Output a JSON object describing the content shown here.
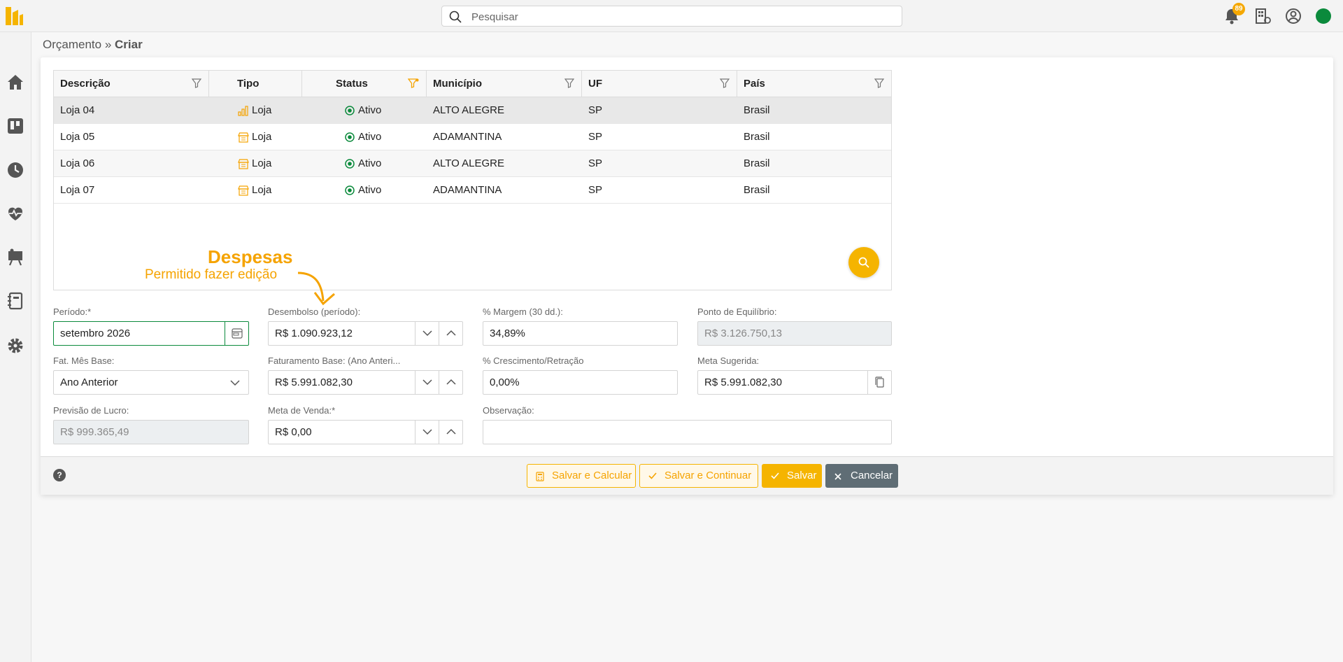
{
  "search": {
    "placeholder": "Pesquisar"
  },
  "header": {
    "notification_count": "89"
  },
  "breadcrumb": {
    "parent": "Orçamento",
    "separator": "»",
    "current": "Criar"
  },
  "grid": {
    "columns": [
      "Descrição",
      "Tipo",
      "Status",
      "Município",
      "UF",
      "País"
    ],
    "rows": [
      {
        "descricao": "Loja 04",
        "tipo": "Loja",
        "status": "Ativo",
        "municipio": "ALTO ALEGRE",
        "uf": "SP",
        "pais": "Brasil"
      },
      {
        "descricao": "Loja 05",
        "tipo": "Loja",
        "status": "Ativo",
        "municipio": "ADAMANTINA",
        "uf": "SP",
        "pais": "Brasil"
      },
      {
        "descricao": "Loja 06",
        "tipo": "Loja",
        "status": "Ativo",
        "municipio": "ALTO ALEGRE",
        "uf": "SP",
        "pais": "Brasil"
      },
      {
        "descricao": "Loja 07",
        "tipo": "Loja",
        "status": "Ativo",
        "municipio": "ADAMANTINA",
        "uf": "SP",
        "pais": "Brasil"
      }
    ]
  },
  "annotation": {
    "title": "Despesas",
    "subtitle": "Permitido fazer edição"
  },
  "form": {
    "periodo": {
      "label": "Período:*",
      "value": "setembro 2026"
    },
    "desembolso": {
      "label": "Desembolso (período):",
      "value": "R$ 1.090.923,12"
    },
    "margem": {
      "label": "% Margem (30 dd.):",
      "value": "34,89%"
    },
    "ponto_equilibrio": {
      "label": "Ponto de Equilíbrio:",
      "value": "R$ 3.126.750,13"
    },
    "fat_mes_base": {
      "label": "Fat. Mês Base:",
      "value": "Ano Anterior"
    },
    "faturamento_base": {
      "label": "Faturamento Base: (Ano Anteri...",
      "value": "R$ 5.991.082,30"
    },
    "crescimento": {
      "label": "% Crescimento/Retração",
      "value": "0,00%"
    },
    "meta_sugerida": {
      "label": "Meta Sugerida:",
      "value": "R$ 5.991.082,30"
    },
    "previsao_lucro": {
      "label": "Previsão de Lucro:",
      "value": "R$ 999.365,49"
    },
    "meta_venda": {
      "label": "Meta de Venda:*",
      "value": "R$ 0,00"
    },
    "observacao": {
      "label": "Observação:",
      "value": ""
    }
  },
  "footer": {
    "help": "?",
    "salvar_calcular": "Salvar e Calcular",
    "salvar_continuar": "Salvar e Continuar",
    "salvar": "Salvar",
    "cancelar": "Cancelar"
  },
  "colors": {
    "accent": "#f5b400",
    "success": "#0b8a3c",
    "cancel": "#5f6d75"
  }
}
